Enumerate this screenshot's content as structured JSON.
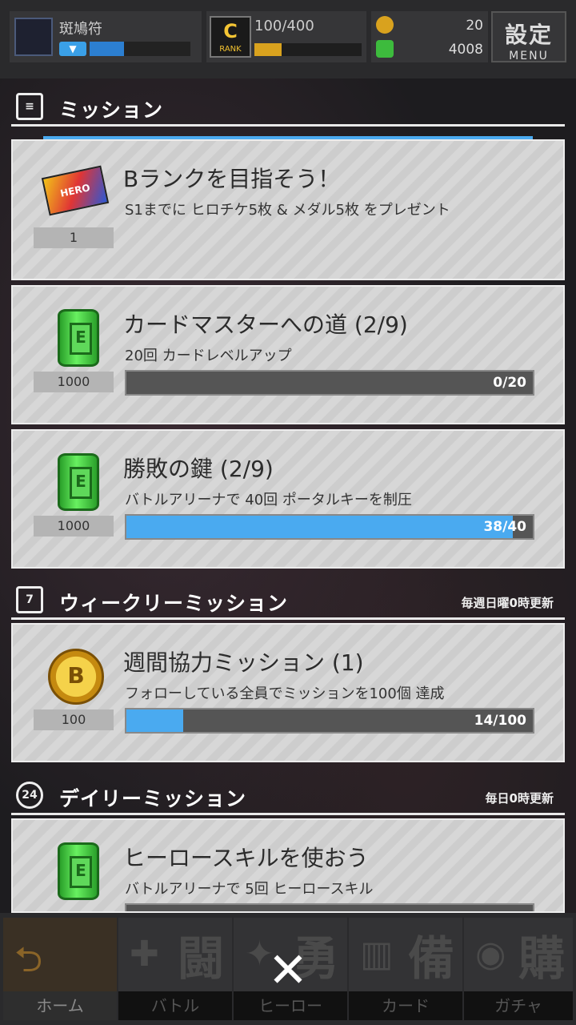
{
  "header": {
    "player_name": "斑鳩符",
    "rank_value": "100/400",
    "rank_label": "RANK",
    "currency_gold": "20",
    "currency_green": "4008",
    "settings_kanji": "設定",
    "settings_menu": "MENU"
  },
  "sections": {
    "mission": {
      "title": "ミッション"
    },
    "weekly": {
      "title": "ウィークリーミッション",
      "note": "毎週日曜0時更新",
      "icon": "7"
    },
    "daily": {
      "title": "デイリーミッション",
      "note": "毎日0時更新",
      "icon": "24"
    }
  },
  "missions": [
    {
      "title": "Bランクを目指そう！",
      "desc": "S1までに ヒロチケ5枚 & メダル5枚 をプレゼント",
      "count": "1",
      "icon": "hero-ticket-icon"
    },
    {
      "title": "カードマスターへの道 (2/9)",
      "desc": "20回 カードレベルアップ",
      "count": "1000",
      "progress": "0/20",
      "fill": 0.0,
      "icon": "green-barrel-icon"
    },
    {
      "title": "勝敗の鍵 (2/9)",
      "desc": "バトルアリーナで 40回 ポータルキーを制圧",
      "count": "1000",
      "progress": "38/40",
      "fill": 0.95,
      "icon": "green-barrel-icon"
    },
    {
      "title": "週間協力ミッション (1)",
      "desc": "フォローしている全員でミッションを100個 達成",
      "count": "100",
      "progress": "14/100",
      "fill": 0.14,
      "icon": "gold-coin-icon"
    },
    {
      "title": "ヒーロースキルを使おう",
      "desc": "バトルアリーナで 5回 ヒーロースキル",
      "count": "",
      "icon": "green-barrel-icon"
    }
  ],
  "nav": [
    {
      "label": "ホーム"
    },
    {
      "label": "バトル",
      "kanji": "闘"
    },
    {
      "label": "ヒーロー",
      "kanji": "勇"
    },
    {
      "label": "カード",
      "kanji": "備"
    },
    {
      "label": "ガチャ",
      "kanji": "購"
    }
  ],
  "close_symbol": "✕"
}
